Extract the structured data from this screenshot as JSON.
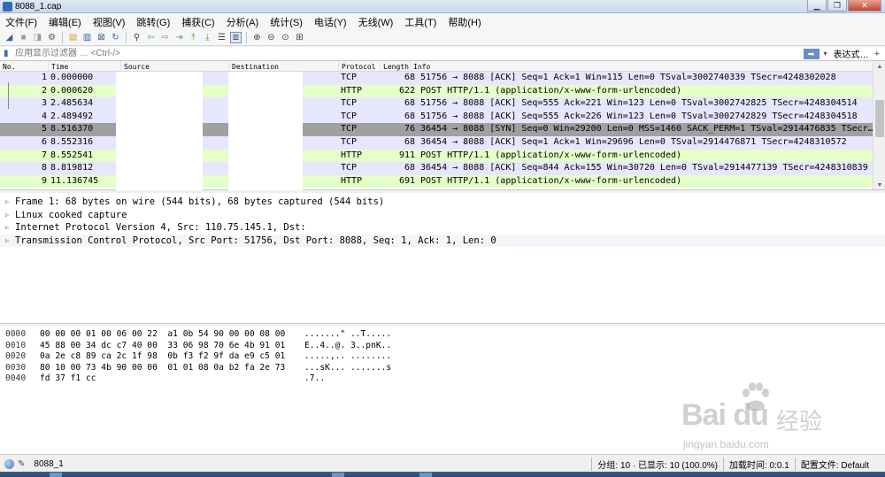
{
  "window": {
    "title": "8088_1.cap",
    "buttons": [
      "0",
      "1",
      "r"
    ]
  },
  "menu": [
    "文件(F)",
    "编辑(E)",
    "视图(V)",
    "跳转(G)",
    "捕获(C)",
    "分析(A)",
    "统计(S)",
    "电话(Y)",
    "无线(W)",
    "工具(T)",
    "帮助(H)"
  ],
  "toolbar": {
    "icons": [
      "shark-start-icon",
      "stop-icon",
      "restart-icon",
      "options-icon",
      "open-icon",
      "save-icon",
      "close-file-icon",
      "reload-icon",
      "find-icon",
      "back-icon",
      "forward-icon",
      "goto-icon",
      "first-icon",
      "last-icon",
      "autoscroll-icon",
      "colorize-icon",
      "zoom-in-icon",
      "zoom-out-icon",
      "normal-size-icon",
      "resize-columns-icon"
    ]
  },
  "filter": {
    "placeholder": "应用显示过滤器 … <Ctrl-/>",
    "expression_label": "表达式…",
    "plus": "+"
  },
  "packet_list": {
    "columns": [
      "No.",
      "Time",
      "Source",
      "Destination",
      "Protocol",
      "Length",
      "Info"
    ],
    "rows": [
      {
        "no": "1",
        "time": "0.000000",
        "proto": "TCP",
        "len": "68",
        "info": "51756 → 8088 [ACK] Seq=1 Ack=1 Win=115 Len=0 TSval=3002740339 TSecr=4248302028",
        "bg": "#e7e6ff",
        "fg": "#000000"
      },
      {
        "no": "2",
        "time": "0.000620",
        "proto": "HTTP",
        "len": "622",
        "info": "POST                           HTTP/1.1  (application/x-www-form-urlencoded)",
        "bg": "#e4ffc7",
        "fg": "#000000"
      },
      {
        "no": "3",
        "time": "2.485634",
        "proto": "TCP",
        "len": "68",
        "info": "51756 → 8088 [ACK] Seq=555 Ack=221 Win=123 Len=0 TSval=3002742825 TSecr=4248304514",
        "bg": "#e7e6ff",
        "fg": "#000000"
      },
      {
        "no": "4",
        "time": "2.489492",
        "proto": "TCP",
        "len": "68",
        "info": "51756 → 8088 [ACK] Seq=555 Ack=226 Win=123 Len=0 TSval=3002742829 TSecr=4248304518",
        "bg": "#e7e6ff",
        "fg": "#000000"
      },
      {
        "no": "5",
        "time": "8.516370",
        "proto": "TCP",
        "len": "76",
        "info": "36454 → 8088 [SYN] Seq=0 Win=29200 Len=0 MSS=1460 SACK_PERM=1 TSval=2914476835 TSecr…",
        "bg": "#a0a0a0",
        "fg": "#000000"
      },
      {
        "no": "6",
        "time": "8.552316",
        "proto": "TCP",
        "len": "68",
        "info": "36454 → 8088 [ACK] Seq=1 Ack=1 Win=29696 Len=0 TSval=2914476871 TSecr=4248310572",
        "bg": "#e7e6ff",
        "fg": "#000000"
      },
      {
        "no": "7",
        "time": "8.552541",
        "proto": "HTTP",
        "len": "911",
        "info": "POST                           HTTP/1.1  (application/x-www-form-urlencoded)",
        "bg": "#e4ffc7",
        "fg": "#000000"
      },
      {
        "no": "8",
        "time": "8.819812",
        "proto": "TCP",
        "len": "68",
        "info": "36454 → 8088 [ACK] Seq=844 Ack=155 Win=30720 Len=0 TSval=2914477139 TSecr=4248310839",
        "bg": "#e7e6ff",
        "fg": "#000000"
      },
      {
        "no": "9",
        "time": "11.136745",
        "proto": "HTTP",
        "len": "691",
        "info": "POST                                 HTTP/1.1  (application/x-www-form-urlencoded)",
        "bg": "#e4ffc7",
        "fg": "#000000"
      }
    ]
  },
  "details": [
    "Frame 1: 68 bytes on wire (544 bits), 68 bytes captured (544 bits)",
    "Linux cooked capture",
    "Internet Protocol Version 4, Src: 110.75.145.1, Dst: ",
    "Transmission Control Protocol, Src Port: 51756, Dst Port: 8088, Seq: 1, Ack: 1, Len: 0"
  ],
  "bytes": [
    {
      "off": "0000",
      "hex": "00 00 00 01 00 06 00 22  a1 0b 54 90 00 00 08 00",
      "ascii": ".......\" ..T....."
    },
    {
      "off": "0010",
      "hex": "45 88 00 34 dc c7 40 00  33 06 98 70 6e 4b 91 01",
      "ascii": "E..4..@. 3..pnK.."
    },
    {
      "off": "0020",
      "hex": "0a 2e c8 89 ca 2c 1f 98  0b f3 f2 9f da e9 c5 01",
      "ascii": ".....,.. ........"
    },
    {
      "off": "0030",
      "hex": "80 10 00 73 4b 90 00 00  01 01 08 0a b2 fa 2e 73",
      "ascii": "...sK... .......s"
    },
    {
      "off": "0040",
      "hex": "fd 37 f1 cc",
      "ascii": ".7.."
    }
  ],
  "status": {
    "file": "8088_1",
    "packets": "分组: 10 · 已显示: 10 (100.0%)",
    "load_time": "加载时间: 0:0.1",
    "profile": "配置文件: Default"
  },
  "watermark": {
    "logo": "Bai du",
    "cn": "经验",
    "url": "jingyan.baidu.com"
  }
}
